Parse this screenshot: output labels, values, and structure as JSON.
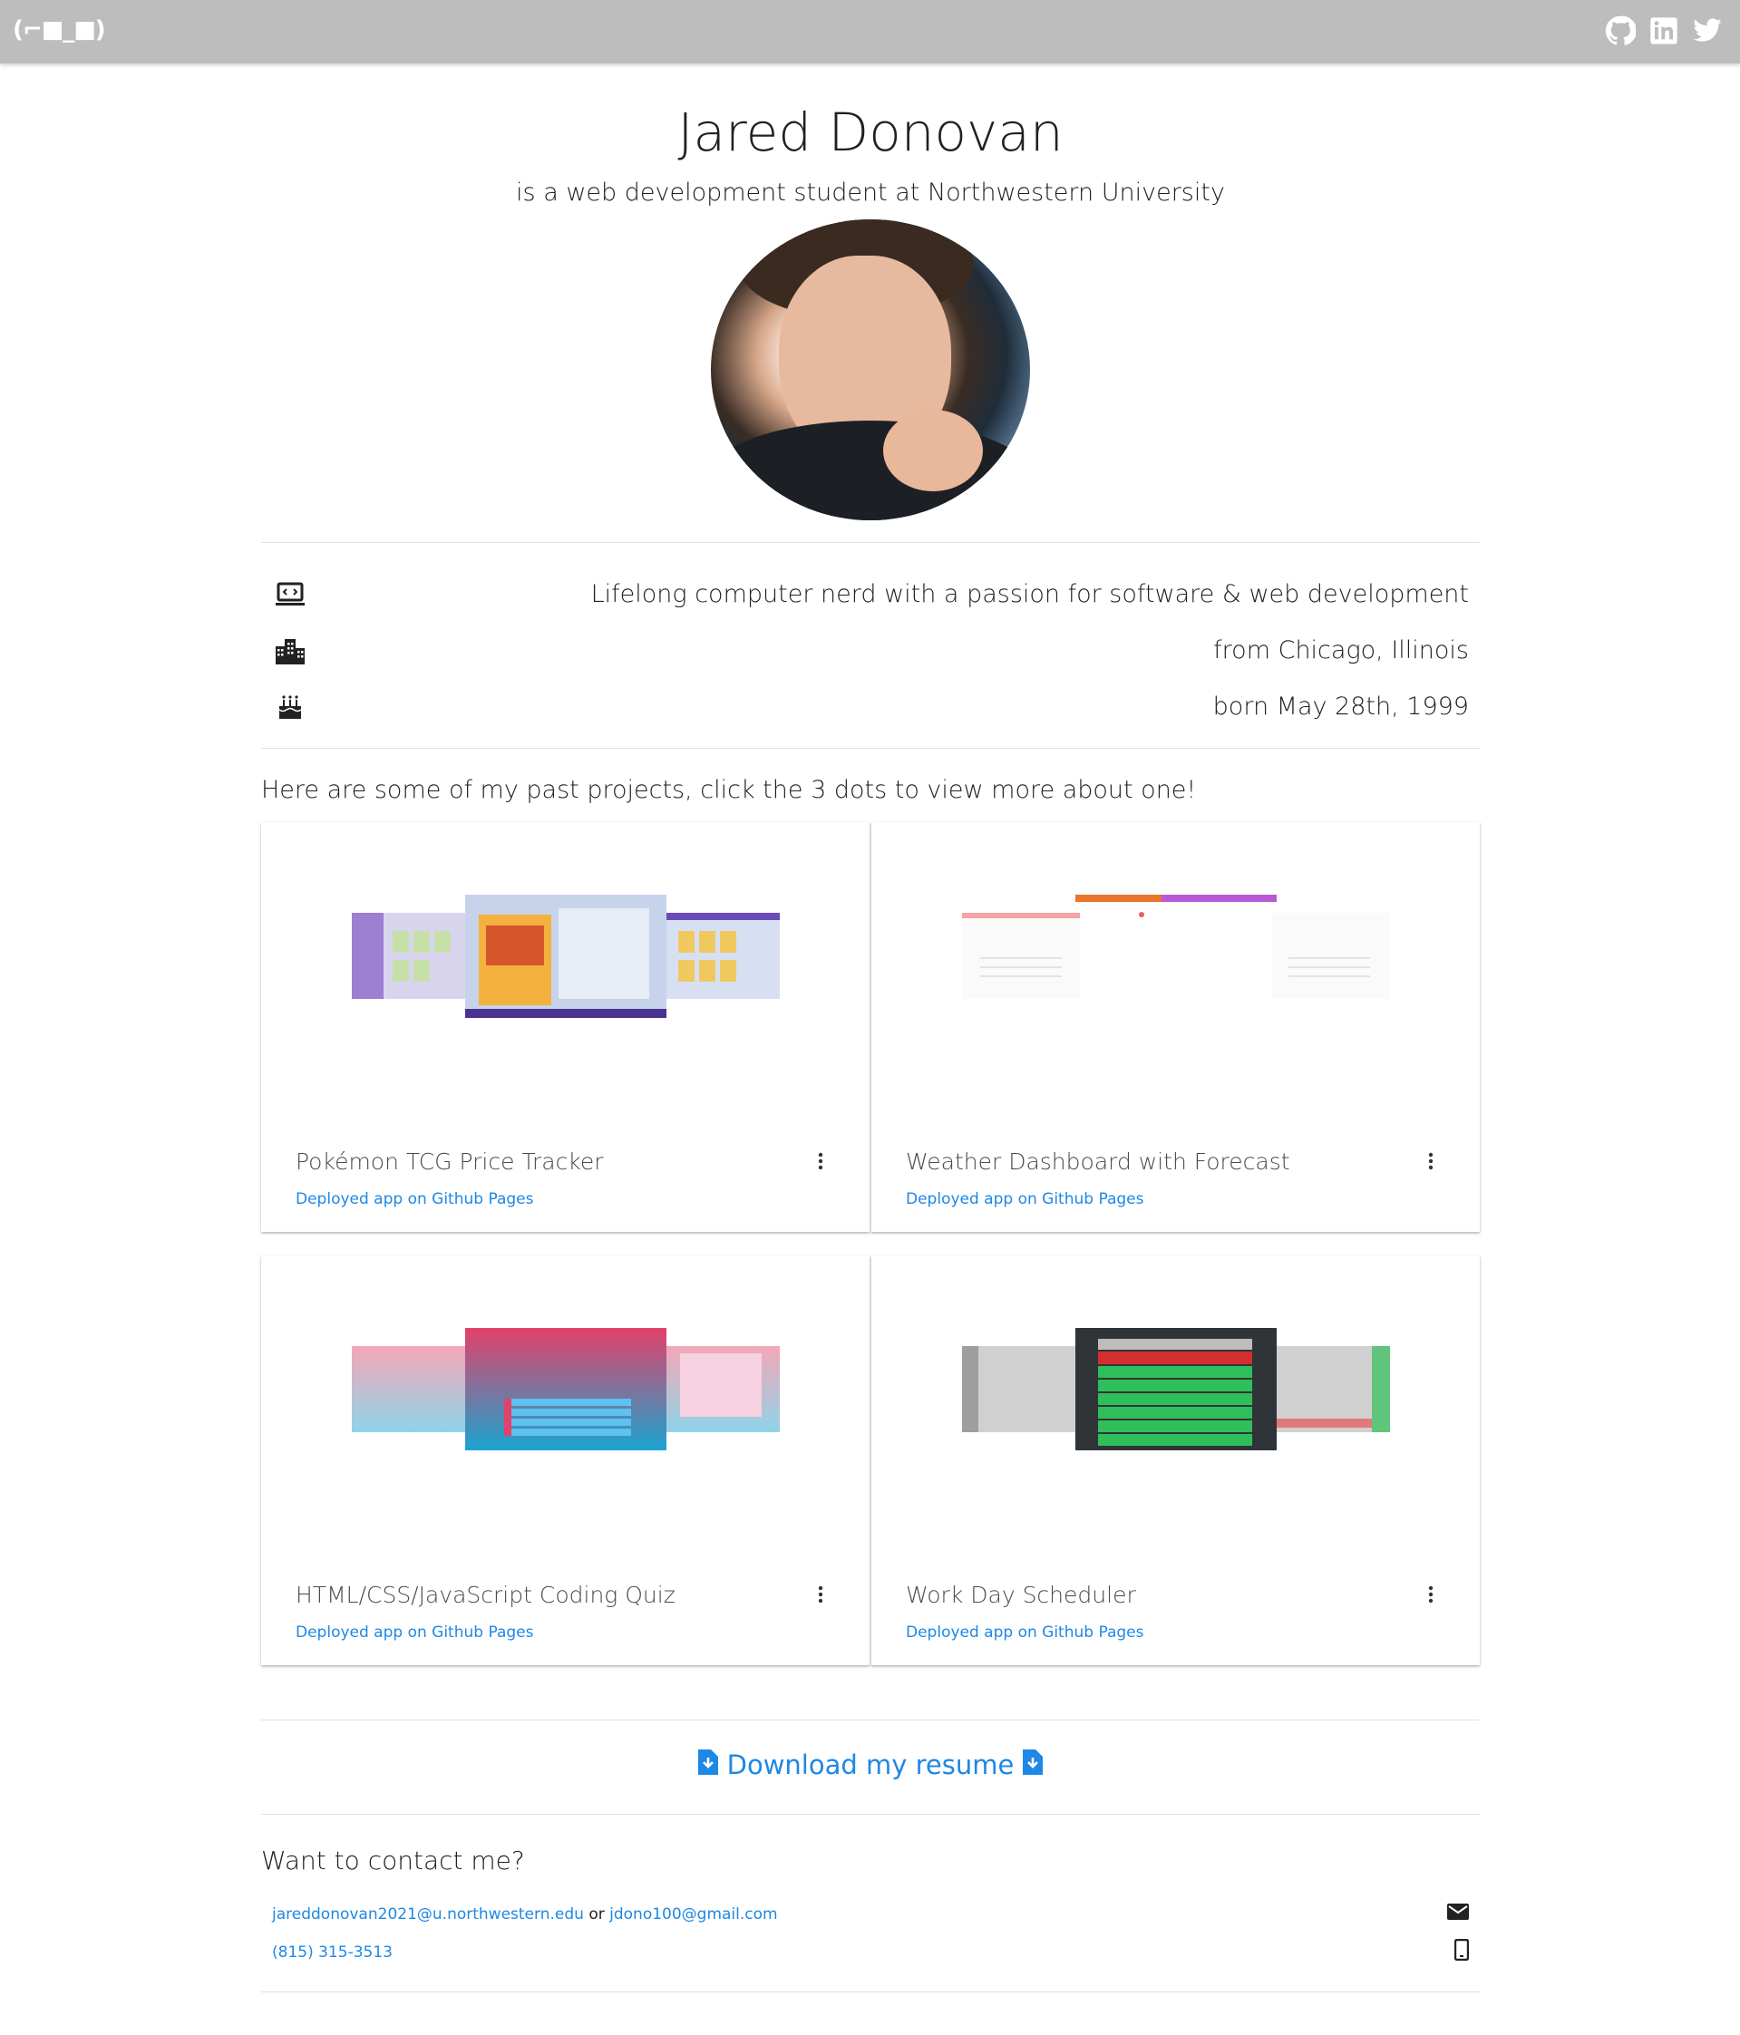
{
  "navbar": {
    "brand": "(⌐■_■)",
    "social": [
      "github-icon",
      "linkedin-icon",
      "twitter-icon"
    ],
    "color": "#bdbdbd"
  },
  "header": {
    "name": "Jared Donovan",
    "tagline": "is a web development student at Northwestern University"
  },
  "facts": [
    {
      "icon": "laptop-code-icon",
      "text": "Lifelong computer nerd with a passion for software & web development"
    },
    {
      "icon": "city-icon",
      "text": "from Chicago, Illinois"
    },
    {
      "icon": "birthday-cake-icon",
      "text": "born May 28th, 1999"
    }
  ],
  "projects": {
    "intro": "Here are some of my past projects, click the 3 dots to view more about one!",
    "cards": [
      {
        "title": "Pokémon TCG Price Tracker",
        "link": "Deployed app on Github Pages"
      },
      {
        "title": "Weather Dashboard with Forecast",
        "link": "Deployed app on Github Pages"
      },
      {
        "title": "HTML/CSS/JavaScript Coding Quiz",
        "link": "Deployed app on Github Pages"
      },
      {
        "title": "Work Day Scheduler",
        "link": "Deployed app on Github Pages"
      }
    ]
  },
  "resume": {
    "label": "Download my resume",
    "icon": "file-download-icon"
  },
  "contact": {
    "title": "Want to contact me?",
    "email1": "jareddonovan2021@u.northwestern.edu",
    "or": "or",
    "email2": "jdono100@gmail.com",
    "phone": "(815) 315-3513"
  },
  "colors": {
    "link": "#1e88e5",
    "text": "#212121"
  }
}
